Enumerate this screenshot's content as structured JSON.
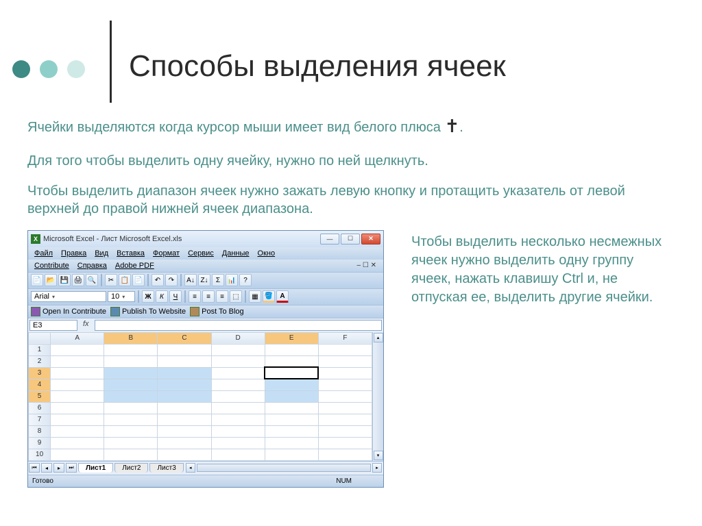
{
  "title": "Способы выделения ячеек",
  "para1": "Ячейки выделяются когда курсор мыши имеет вид белого плюса",
  "para2": "Для того чтобы выделить одну ячейку, нужно по ней щелкнуть.",
  "para3": "Чтобы выделить диапазон ячеек нужно зажать левую кнопку и протащить указатель от левой верхней до правой нижней ячеек диапазона.",
  "para4": "Чтобы выделить несколько несмежных ячеек нужно выделить одну группу ячеек, нажать клавишу Ctrl и, не отпуская ее, выделить другие ячейки.",
  "excel": {
    "win_title": "Microsoft Excel - Лист Microsoft Excel.xls",
    "menus": [
      "Файл",
      "Правка",
      "Вид",
      "Вставка",
      "Формат",
      "Сервис",
      "Данные",
      "Окно"
    ],
    "menus2": [
      "Contribute",
      "Справка",
      "Adobe PDF"
    ],
    "font_name": "Arial",
    "font_size": "10",
    "contribute_items": [
      "Open In Contribute",
      "Publish To Website",
      "Post To Blog"
    ],
    "active_cell": "E3",
    "columns": [
      "A",
      "B",
      "C",
      "D",
      "E",
      "F"
    ],
    "rows": [
      "1",
      "2",
      "3",
      "4",
      "5",
      "6",
      "7",
      "8",
      "9",
      "10"
    ],
    "selection": [
      {
        "row": 3,
        "cols": [
          "B",
          "C"
        ]
      },
      {
        "row": 4,
        "cols": [
          "B",
          "C"
        ]
      },
      {
        "row": 5,
        "cols": [
          "B",
          "C"
        ]
      },
      {
        "row": 3,
        "cols": [
          "E"
        ],
        "active": true
      },
      {
        "row": 4,
        "cols": [
          "E"
        ]
      },
      {
        "row": 5,
        "cols": [
          "E"
        ]
      }
    ],
    "sheet_tabs": [
      "Лист1",
      "Лист2",
      "Лист3"
    ],
    "active_tab": 0,
    "status_ready": "Готово",
    "status_num": "NUM"
  }
}
